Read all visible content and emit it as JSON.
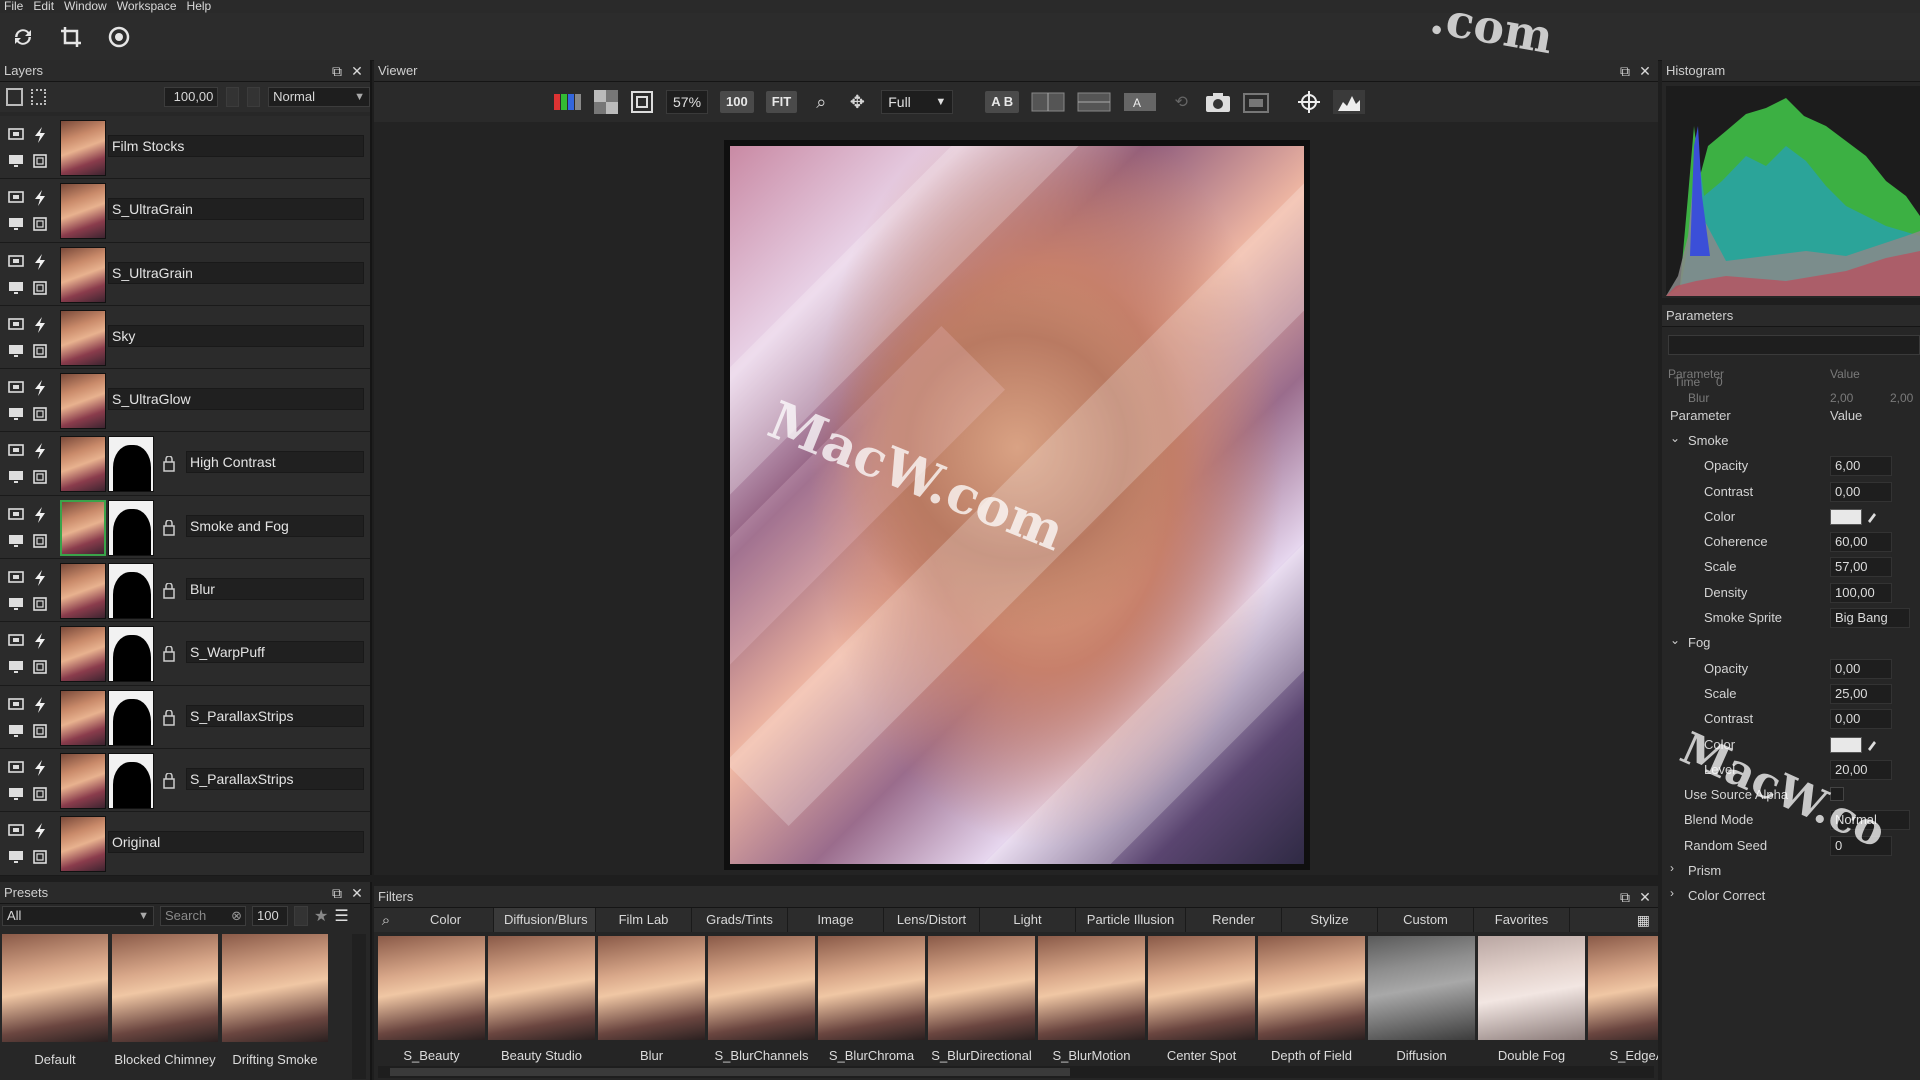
{
  "menu": [
    "File",
    "Edit",
    "Window",
    "Workspace",
    "Help"
  ],
  "toolbar": {
    "icons": [
      "refresh-icon",
      "crop-icon",
      "target-icon"
    ]
  },
  "layers": {
    "title": "Layers",
    "opacity": "100,00",
    "blend_mode": "Normal",
    "items": [
      {
        "name": "Film Stocks",
        "mask": false
      },
      {
        "name": "S_UltraGrain",
        "mask": false
      },
      {
        "name": "S_UltraGrain",
        "mask": false
      },
      {
        "name": "Sky",
        "mask": false
      },
      {
        "name": "S_UltraGlow",
        "mask": false
      },
      {
        "name": "High Contrast",
        "mask": true
      },
      {
        "name": "Smoke and Fog",
        "mask": true,
        "selected": true
      },
      {
        "name": "Blur",
        "mask": true
      },
      {
        "name": "S_WarpPuff",
        "mask": true
      },
      {
        "name": "S_ParallaxStrips",
        "mask": true
      },
      {
        "name": "S_ParallaxStrips",
        "mask": true
      },
      {
        "name": "Original",
        "mask": false
      }
    ]
  },
  "presets": {
    "title": "Presets",
    "category": "All",
    "search_placeholder": "Search",
    "size": "100",
    "items": [
      "Default",
      "Blocked Chimney",
      "Drifting Smoke"
    ]
  },
  "viewer": {
    "title": "Viewer",
    "zoom": "57%",
    "zoom_100": "100",
    "fit": "FIT",
    "resolution": "Full",
    "ab_label": "A B"
  },
  "histogram": {
    "title": "Histogram"
  },
  "parameters": {
    "title": "Parameters",
    "ghost_header": {
      "param": "Parameter",
      "value": "Value",
      "time": "Time",
      "time_value": "0",
      "blur": "Blur",
      "blur_v1": "2,00",
      "blur_v2": "2,00"
    },
    "col_param": "Parameter",
    "col_value": "Value",
    "rows": [
      {
        "type": "group",
        "label": "Smoke",
        "open": true
      },
      {
        "type": "num",
        "label": "Opacity",
        "value": "6,00"
      },
      {
        "type": "num",
        "label": "Contrast",
        "value": "0,00"
      },
      {
        "type": "color",
        "label": "Color"
      },
      {
        "type": "num",
        "label": "Coherence",
        "value": "60,00"
      },
      {
        "type": "num",
        "label": "Scale",
        "value": "57,00"
      },
      {
        "type": "num",
        "label": "Density",
        "value": "100,00"
      },
      {
        "type": "select",
        "label": "Smoke Sprite",
        "value": "Big Bang"
      },
      {
        "type": "group",
        "label": "Fog",
        "open": true
      },
      {
        "type": "num",
        "label": "Opacity",
        "value": "0,00"
      },
      {
        "type": "num",
        "label": "Scale",
        "value": "25,00"
      },
      {
        "type": "num",
        "label": "Contrast",
        "value": "0,00"
      },
      {
        "type": "color",
        "label": "Color"
      },
      {
        "type": "num",
        "label": "Level",
        "value": "20,00"
      },
      {
        "type": "check",
        "label": "Use Source Alpha",
        "indent": 1
      },
      {
        "type": "select",
        "label": "Blend Mode",
        "value": "Normal",
        "indent": 1
      },
      {
        "type": "num",
        "label": "Random Seed",
        "value": "0",
        "indent": 1
      },
      {
        "type": "group",
        "label": "Prism",
        "open": false
      },
      {
        "type": "group",
        "label": "Color Correct",
        "open": false
      }
    ]
  },
  "filters": {
    "title": "Filters",
    "tabs": [
      "Color",
      "Diffusion/Blurs",
      "Film Lab",
      "Grads/Tints",
      "Image",
      "Lens/Distort",
      "Light",
      "Particle Illusion",
      "Render",
      "Stylize",
      "Custom",
      "Favorites"
    ],
    "active_tab": "Diffusion/Blurs",
    "items": [
      "S_Beauty",
      "Beauty Studio",
      "Blur",
      "S_BlurChannels",
      "S_BlurChroma",
      "S_BlurDirectional",
      "S_BlurMotion",
      "Center Spot",
      "Depth of Field",
      "Diffusion",
      "Double Fog",
      "S_EdgeAw"
    ]
  },
  "watermarks": [
    "MacW.com",
    "MacW.co",
    ".com"
  ]
}
